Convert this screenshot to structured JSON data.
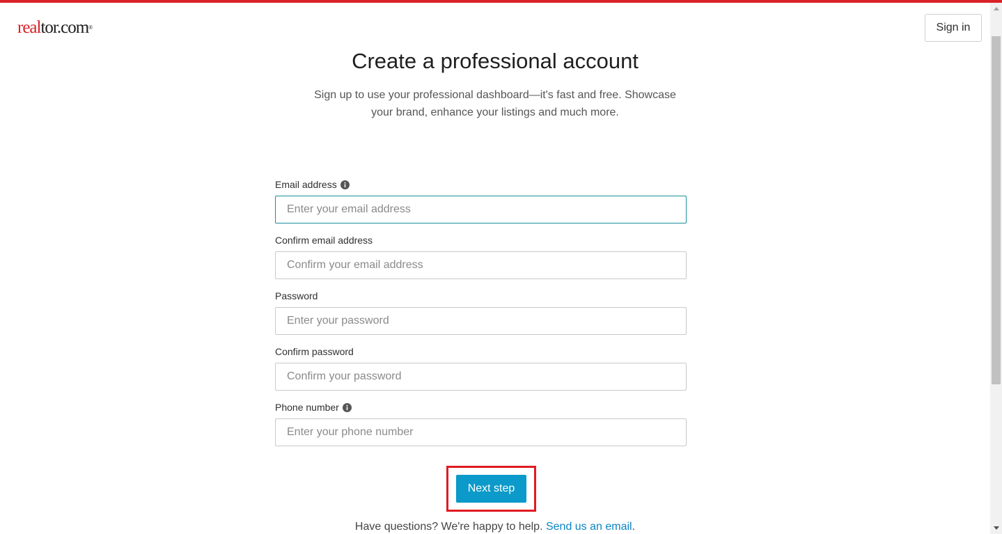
{
  "header": {
    "logo": {
      "part1": "real",
      "part2": "tor.com",
      "reg": "®"
    },
    "signin_label": "Sign in"
  },
  "main": {
    "title": "Create a professional account",
    "subtitle": "Sign up to use your professional dashboard—it's fast and free. Showcase your brand, enhance your listings and much more."
  },
  "form": {
    "fields": [
      {
        "label": "Email address",
        "placeholder": "Enter your email address",
        "value": "",
        "has_info": true,
        "focused": true
      },
      {
        "label": "Confirm email address",
        "placeholder": "Confirm your email address",
        "value": "",
        "has_info": false
      },
      {
        "label": "Password",
        "placeholder": "Enter your password",
        "value": "",
        "has_info": false
      },
      {
        "label": "Confirm password",
        "placeholder": "Confirm your password",
        "value": "",
        "has_info": false
      },
      {
        "label": "Phone number",
        "placeholder": "Enter your phone number",
        "value": "",
        "has_info": true
      }
    ],
    "next_label": "Next step"
  },
  "help": {
    "text": "Have questions? We're happy to help.",
    "link_text": "Send us an email",
    "suffix": "."
  },
  "colors": {
    "brand_red": "#d92228",
    "primary_button": "#0b9ac9",
    "link": "#0b84c2",
    "focus_border": "#1a8f9a",
    "highlight_box": "#e01a22"
  },
  "icons": {
    "info": "info-icon",
    "scroll_up": "chevron-up-icon",
    "scroll_down": "chevron-down-icon"
  }
}
